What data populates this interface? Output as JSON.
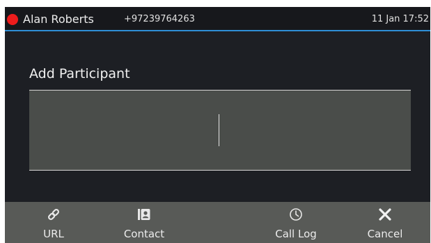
{
  "status_bar": {
    "caller_name": "Alan Roberts",
    "caller_number": "+97239764263",
    "datetime": "11 Jan 17:52",
    "status_color": "#ee1c1c",
    "accent_color": "#2e8fd6"
  },
  "dialog": {
    "title": "Add Participant",
    "input_value": ""
  },
  "softkeys": [
    {
      "label": "URL",
      "icon": "link-icon"
    },
    {
      "label": "Contact",
      "icon": "contact-card-icon"
    },
    {
      "label": "Call Log",
      "icon": "clock-icon"
    },
    {
      "label": "Cancel",
      "icon": "close-icon"
    }
  ]
}
